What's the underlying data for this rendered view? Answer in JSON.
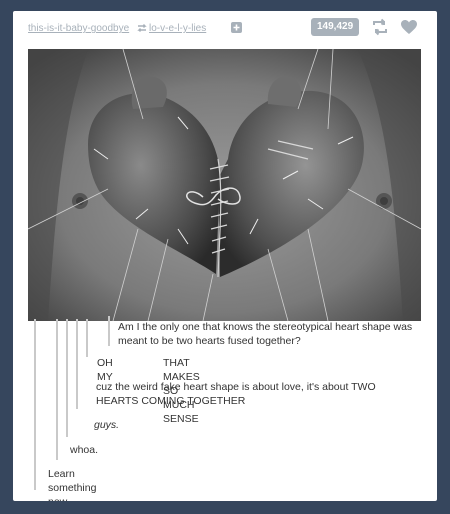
{
  "post": {
    "header": {
      "source_user": "this-is-it-baby-goodbye",
      "reblogged_user": "lo-v-e-l-y-lies",
      "notes_count": "149,429",
      "icons": {
        "reblog_small": "reblog-icon",
        "follow": "plus-icon",
        "reblog": "reblog-icon",
        "like": "heart-icon"
      }
    },
    "thread": {
      "comment_1": "Am I the only one that knows the stereotypical heart shape was meant to be two hearts fused together?",
      "comment_2_left": "OH MY",
      "comment_2_right": "THAT MAKES SO MUCH SENSE",
      "comment_3": "cuz the weird fake heart shape is about love, it's about TWO HEARTS COMING TOGETHER",
      "comment_4": "guys.",
      "comment_5": "whoa.",
      "comment_6": "Learn something new everyday."
    },
    "colors": {
      "background": "#36465d",
      "card": "#ffffff",
      "muted": "#a8b1ba",
      "highlight": "#f8f2a6"
    }
  }
}
